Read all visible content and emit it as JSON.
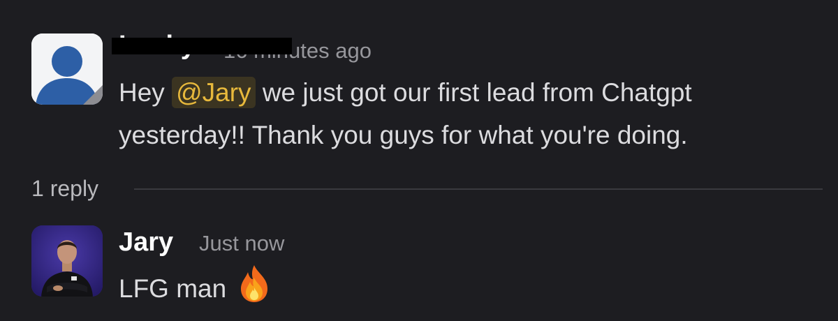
{
  "message1": {
    "author": "Lucky",
    "time": "16 minutes ago",
    "avatar_icon": "default-user-icon",
    "text_before_mention": "Hey ",
    "mention": "@Jary",
    "text_after_mention": " we just got our first lead from Chatgpt",
    "text_line2": "yesterday!! Thank you guys for what you're doing."
  },
  "thread": {
    "reply_count": "1 reply"
  },
  "message2": {
    "author": "Jary",
    "time": "Just now",
    "avatar_icon": "profile-photo",
    "text": "LFG man",
    "emoji_icon": "fire-emoji-icon"
  },
  "colors": {
    "background": "#1d1d21",
    "mention_bg": "#3b3421",
    "mention_text": "#e8b93c",
    "avatar_default_blue": "#2d5fa6"
  }
}
